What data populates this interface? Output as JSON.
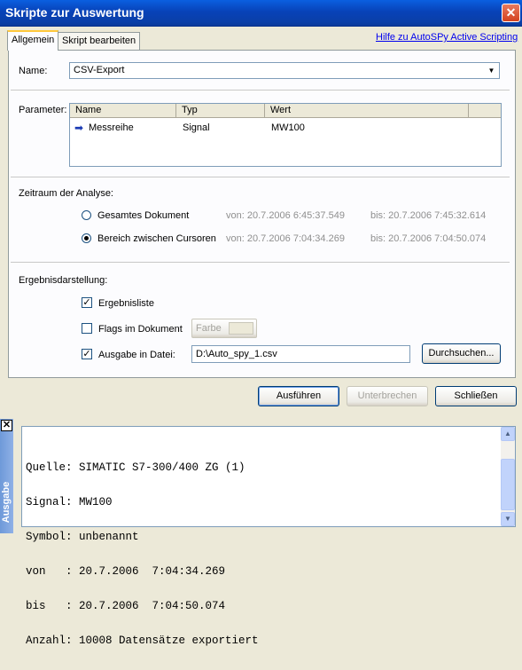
{
  "window": {
    "title": "Skripte zur Auswertung",
    "close": "✕"
  },
  "tabs": [
    "Allgemein",
    "Skript bearbeiten"
  ],
  "help_link": "Hilfe zu AutoSPy Active Scripting",
  "name": {
    "label": "Name:",
    "value": "CSV-Export"
  },
  "parameter": {
    "label": "Parameter:",
    "columns": [
      "Name",
      "Typ",
      "Wert"
    ],
    "rows": [
      {
        "name": "Messreihe",
        "typ": "Signal",
        "wert": "MW100"
      }
    ]
  },
  "zeitraum": {
    "label": "Zeitraum der Analyse:",
    "options": [
      {
        "label": "Gesamtes Dokument",
        "von": "von: 20.7.2006  6:45:37.549",
        "bis": "bis:  20.7.2006  7:45:32.614",
        "selected": false
      },
      {
        "label": "Bereich zwischen Cursoren",
        "von": "von: 20.7.2006  7:04:34.269",
        "bis": "bis:  20.7.2006  7:04:50.074",
        "selected": true
      }
    ]
  },
  "ergebnis": {
    "label": "Ergebnisdarstellung:",
    "ergebnisliste": {
      "label": "Ergebnisliste",
      "checked": true
    },
    "flags": {
      "label": "Flags im Dokument",
      "checked": false,
      "farbe": "Farbe"
    },
    "ausgabe": {
      "label": "Ausgabe in Datei:",
      "checked": true,
      "file": "D:\\Auto_spy_1.csv",
      "browse": "Durchsuchen..."
    }
  },
  "buttons": {
    "run": "Ausführen",
    "stop": "Unterbrechen",
    "close": "Schließen"
  },
  "output": {
    "title": "Ausgabe",
    "lines": [
      "Quelle: SIMATIC S7-300/400 ZG (1)",
      "Signal: MW100",
      "Symbol: unbenannt",
      "von   : 20.7.2006  7:04:34.269",
      "bis   : 20.7.2006  7:04:50.074",
      "Anzahl: 10008 Datensätze exportiert"
    ]
  },
  "colors": {
    "titlebar": "#0842b8",
    "face": "#ece9d8",
    "link": "#0000ee"
  },
  "icons": [
    "close-icon",
    "dropdown-arrow-icon",
    "arrow-right-icon",
    "scroll-up-icon",
    "scroll-down-icon"
  ]
}
